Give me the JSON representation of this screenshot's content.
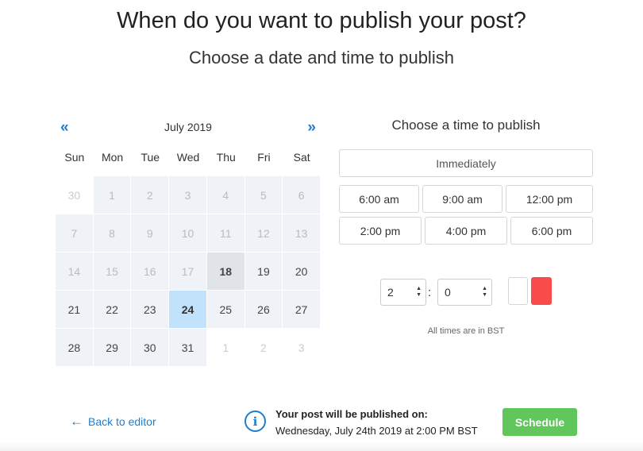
{
  "header": {
    "title": "When do you want to publish your post?",
    "subtitle": "Choose a date and time to publish"
  },
  "calendar": {
    "prev_icon": "«",
    "next_icon": "»",
    "month_label": "July 2019",
    "weekdays": [
      "Sun",
      "Mon",
      "Tue",
      "Wed",
      "Thu",
      "Fri",
      "Sat"
    ],
    "weeks": [
      [
        "30",
        "1",
        "2",
        "3",
        "4",
        "5",
        "6"
      ],
      [
        "7",
        "8",
        "9",
        "10",
        "11",
        "12",
        "13"
      ],
      [
        "14",
        "15",
        "16",
        "17",
        "18",
        "19",
        "20"
      ],
      [
        "21",
        "22",
        "23",
        "24",
        "25",
        "26",
        "27"
      ],
      [
        "28",
        "29",
        "30",
        "31",
        "1",
        "2",
        "3"
      ]
    ],
    "today": "18",
    "selected": "24"
  },
  "time_picker": {
    "title": "Choose a time to publish",
    "immediately_label": "Immediately",
    "presets": [
      "6:00 am",
      "9:00 am",
      "12:00 pm",
      "2:00 pm",
      "4:00 pm",
      "6:00 pm"
    ],
    "hour_value": "2",
    "minute_value": "0",
    "colon": ":",
    "timezone_note": "All times are in BST",
    "ampm_active_color": "#fa4b4b"
  },
  "footer": {
    "back_label": "Back to editor",
    "back_icon": "←",
    "info_icon": "i",
    "publish_label": "Your post will be published on:",
    "publish_date": "Wednesday, July 24th 2019 at 2:00 PM BST",
    "schedule_label": "Schedule",
    "schedule_color": "#61c65c"
  }
}
